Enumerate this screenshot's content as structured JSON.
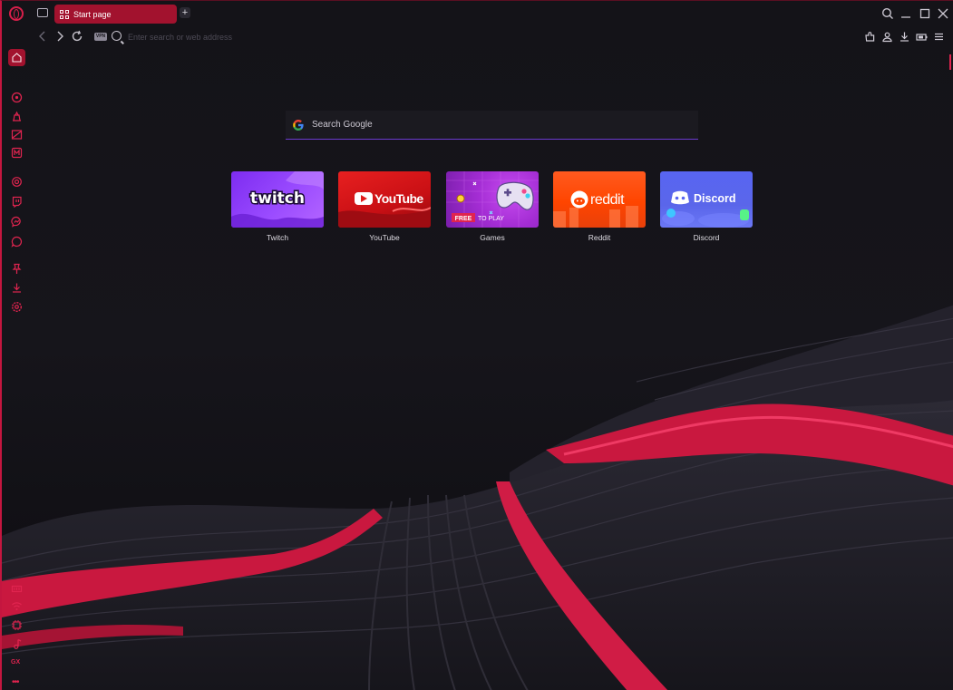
{
  "browser": {
    "tab": {
      "label": "Start page",
      "icon": "grid-icon"
    },
    "new_tab_label": "+",
    "window_controls": {
      "search": "search-icon",
      "minimize": "_",
      "maximize": "□",
      "close": "✕"
    }
  },
  "navbar": {
    "vpn_label": "VPN",
    "address_placeholder": "Enter search or web address",
    "tools": [
      "extensions-icon",
      "account-icon",
      "downloads-icon",
      "battery-saver-icon",
      "easy-setup-icon"
    ]
  },
  "sidebar": {
    "items": [
      "home-icon",
      "aria-icon",
      "gx-corner-icon",
      "player-icon",
      "gx-mods-icon",
      "chatgpt-icon",
      "twitch-icon",
      "messenger-icon",
      "whatsapp-icon",
      "pinboard-icon",
      "downloads-icon",
      "settings-icon",
      "gx-control-icon",
      "network-limiter-icon",
      "cpu-limiter-icon",
      "music-icon"
    ],
    "gx_label": "GX",
    "more_label": "•••"
  },
  "search": {
    "placeholder": "Search Google",
    "provider_icon": "google-icon"
  },
  "speed_dials": [
    {
      "label": "Twitch",
      "logo_text": "twitch",
      "color": "#9146ff"
    },
    {
      "label": "YouTube",
      "logo_text": "YouTube",
      "color": "#e01b1b"
    },
    {
      "label": "Games",
      "badge": "FREE",
      "badge_text": "TO PLAY",
      "color": "#a92bd6"
    },
    {
      "label": "Reddit",
      "logo_text": "reddit",
      "color": "#ff4500"
    },
    {
      "label": "Discord",
      "logo_text": "Discord",
      "color": "#5865f2"
    }
  ],
  "theme": {
    "accent": "#e0244f",
    "tab_active": "#a2122e",
    "background": "#121116"
  }
}
